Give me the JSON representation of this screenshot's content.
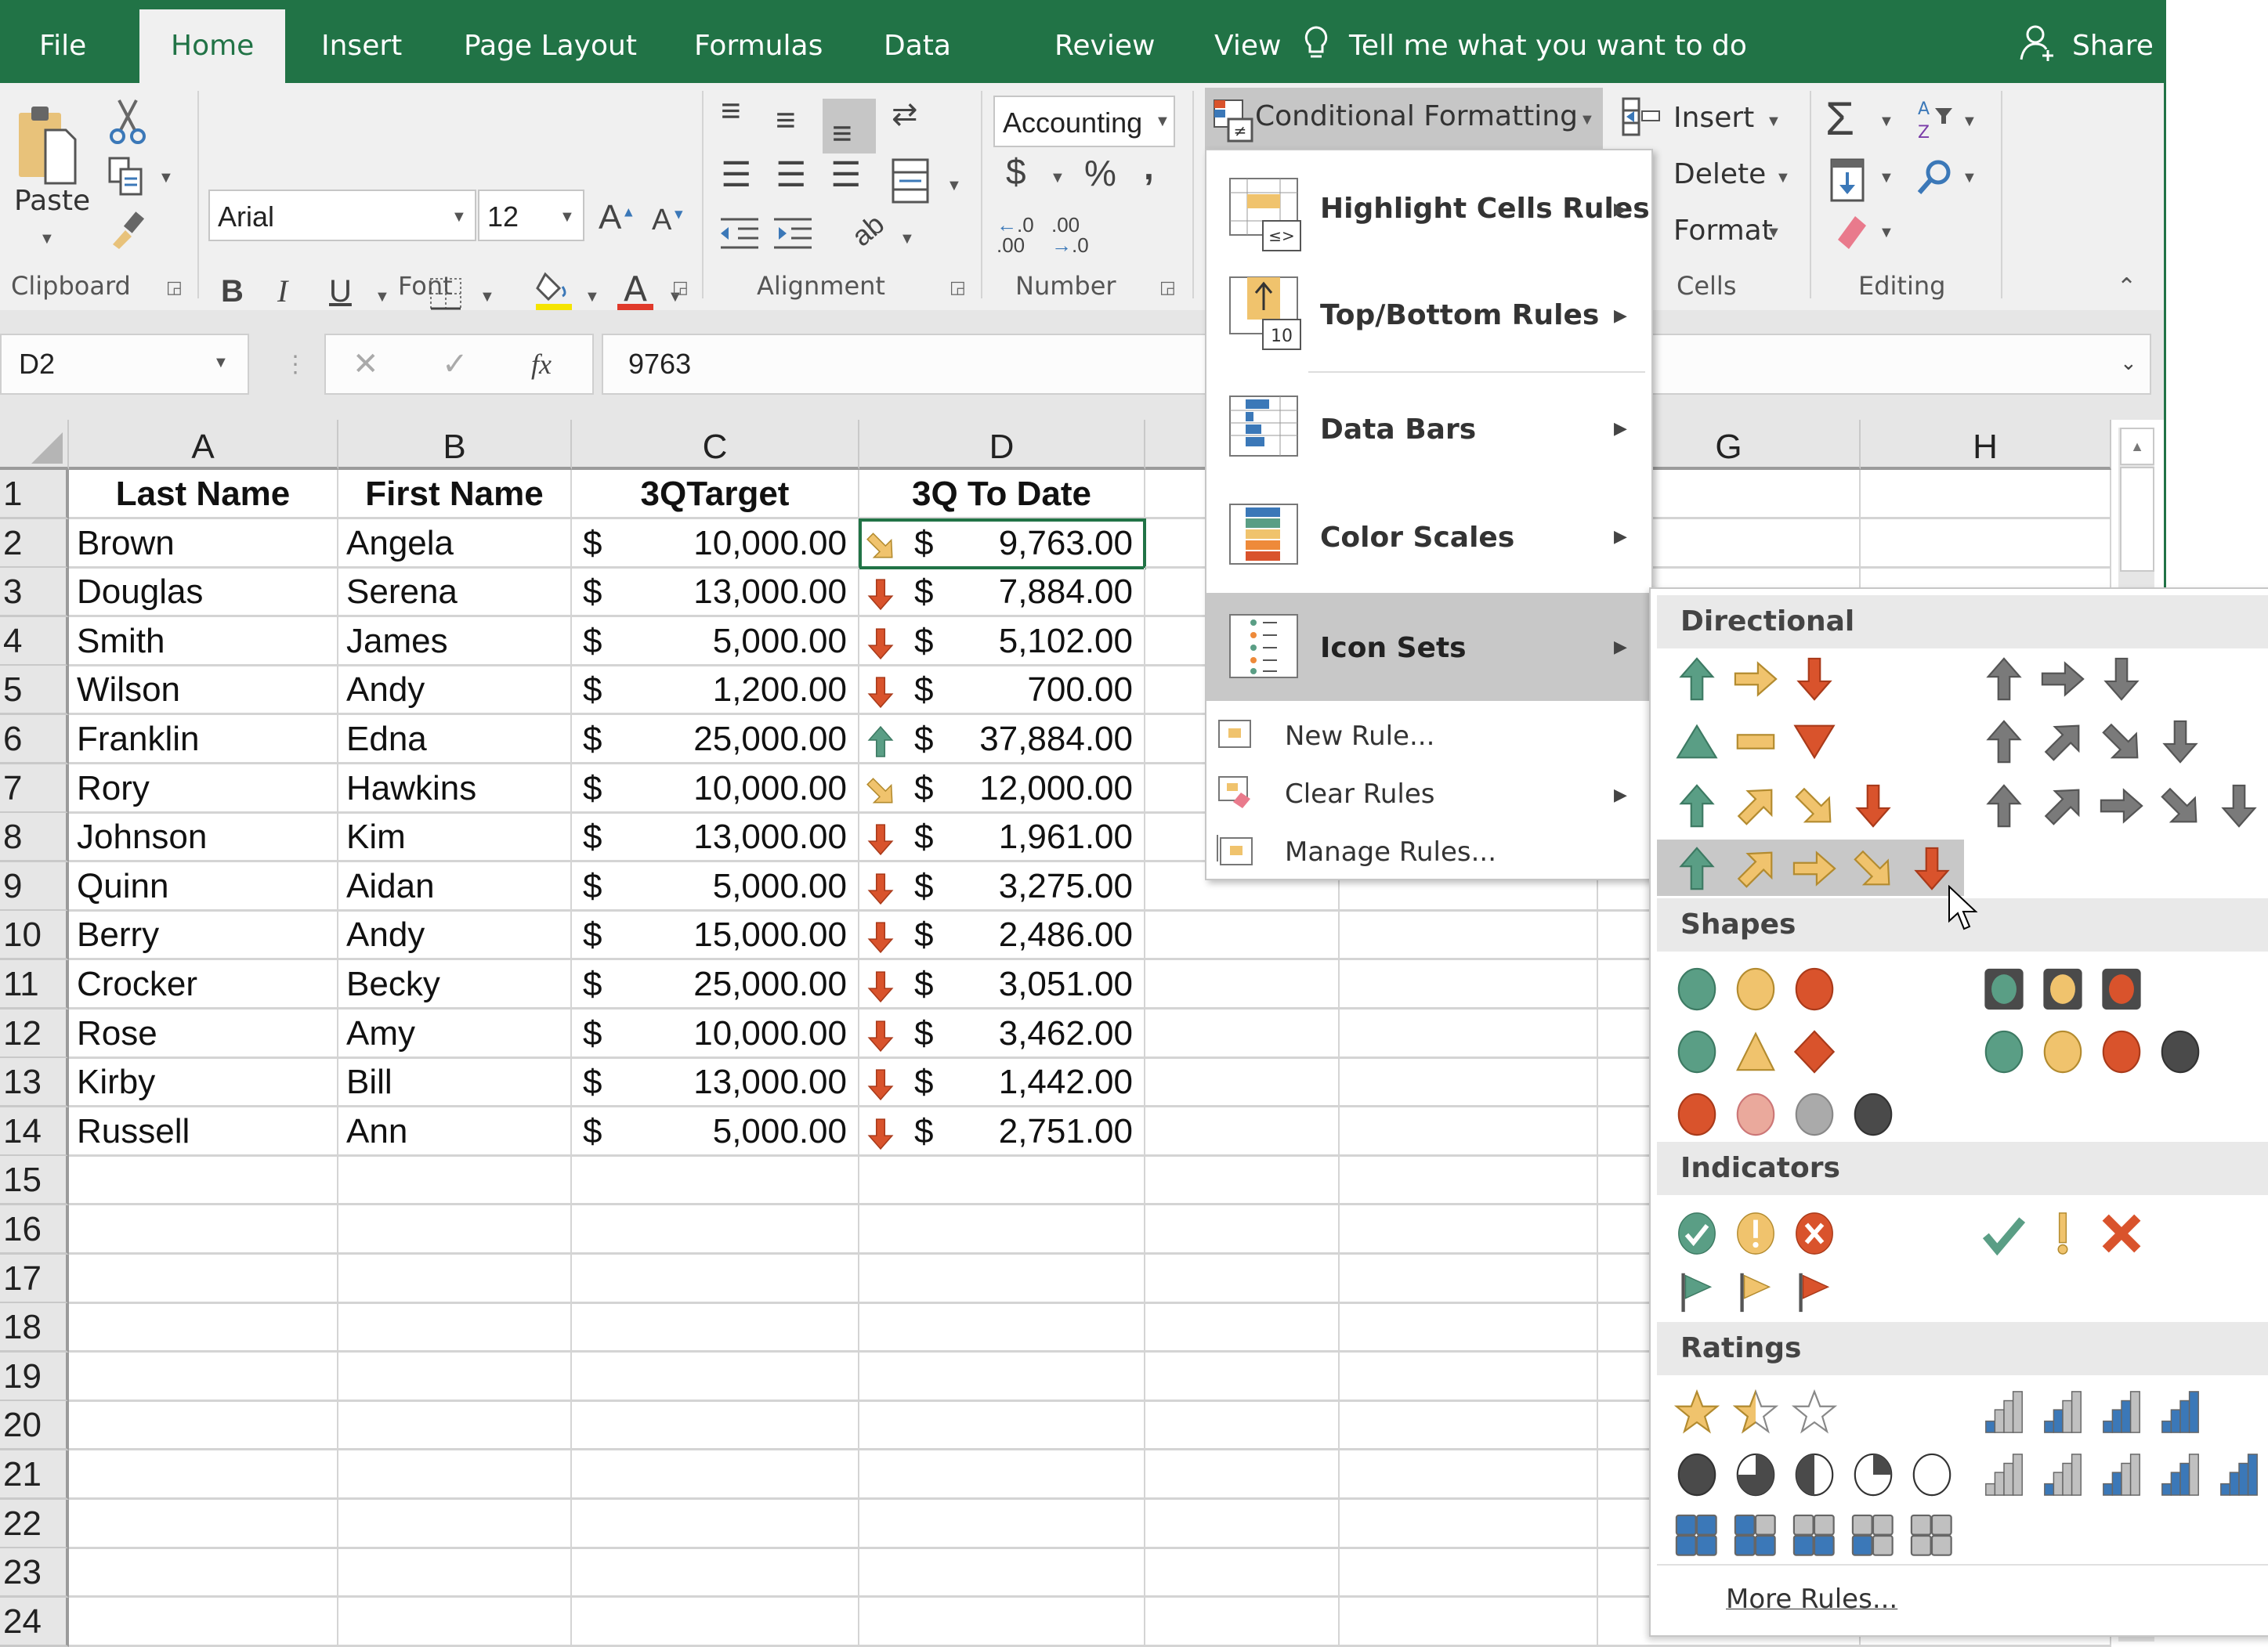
{
  "tabs": [
    "File",
    "Home",
    "Insert",
    "Page Layout",
    "Formulas",
    "Data",
    "Review",
    "View"
  ],
  "active_tab": "Home",
  "tell_me": "Tell me what you want to do",
  "share": "Share",
  "ribbon": {
    "clipboard": {
      "label": "Clipboard",
      "paste": "Paste"
    },
    "font": {
      "label": "Font",
      "font_name": "Arial",
      "font_size": "12",
      "bold": "B",
      "italic": "I",
      "underline": "U"
    },
    "alignment": {
      "label": "Alignment"
    },
    "number": {
      "label": "Number",
      "format": "Accounting",
      "currency": "$",
      "percent": "%",
      "comma": ","
    },
    "styles": {
      "conditional_formatting": "Conditional Formatting"
    },
    "cells": {
      "label": "Cells",
      "insert": "Insert",
      "delete": "Delete",
      "format": "Format"
    },
    "editing": {
      "label": "Editing"
    }
  },
  "formula_bar": {
    "name_box": "D2",
    "value": "9763",
    "fx": "fx"
  },
  "columns": [
    "A",
    "B",
    "C",
    "D",
    "G",
    "H"
  ],
  "rows": [
    "1",
    "2",
    "3",
    "4",
    "5",
    "6",
    "7",
    "8",
    "9",
    "10",
    "11",
    "12",
    "13",
    "14",
    "15",
    "16",
    "17",
    "18",
    "19",
    "20",
    "21",
    "22",
    "23",
    "24"
  ],
  "table": {
    "headers": [
      "Last Name",
      "First Name",
      "3QTarget",
      "3Q To Date"
    ],
    "currency_symbol": "$",
    "records": [
      {
        "last": "Brown",
        "first": "Angela",
        "target": "10,000.00",
        "to_date": "9,763.00",
        "icon": "arrow-down-right-yellow"
      },
      {
        "last": "Douglas",
        "first": "Serena",
        "target": "13,000.00",
        "to_date": "7,884.00",
        "icon": "arrow-down-red"
      },
      {
        "last": "Smith",
        "first": "James",
        "target": "5,000.00",
        "to_date": "5,102.00",
        "icon": "arrow-down-red"
      },
      {
        "last": "Wilson",
        "first": "Andy",
        "target": "1,200.00",
        "to_date": "700.00",
        "icon": "arrow-down-red"
      },
      {
        "last": "Franklin",
        "first": "Edna",
        "target": "25,000.00",
        "to_date": "37,884.00",
        "icon": "arrow-up-green"
      },
      {
        "last": "Rory",
        "first": "Hawkins",
        "target": "10,000.00",
        "to_date": "12,000.00",
        "icon": "arrow-down-right-yellow"
      },
      {
        "last": "Johnson",
        "first": "Kim",
        "target": "13,000.00",
        "to_date": "1,961.00",
        "icon": "arrow-down-red"
      },
      {
        "last": "Quinn",
        "first": "Aidan",
        "target": "5,000.00",
        "to_date": "3,275.00",
        "icon": "arrow-down-red"
      },
      {
        "last": "Berry",
        "first": "Andy",
        "target": "15,000.00",
        "to_date": "2,486.00",
        "icon": "arrow-down-red"
      },
      {
        "last": "Crocker",
        "first": "Becky",
        "target": "25,000.00",
        "to_date": "3,051.00",
        "icon": "arrow-down-red"
      },
      {
        "last": "Rose",
        "first": "Amy",
        "target": "10,000.00",
        "to_date": "3,462.00",
        "icon": "arrow-down-red"
      },
      {
        "last": "Kirby",
        "first": "Bill",
        "target": "13,000.00",
        "to_date": "1,442.00",
        "icon": "arrow-down-red"
      },
      {
        "last": "Russell",
        "first": "Ann",
        "target": "5,000.00",
        "to_date": "2,751.00",
        "icon": "arrow-down-red"
      }
    ]
  },
  "cf_menu": {
    "items": [
      {
        "label": "Highlight Cells Rules",
        "submenu": true
      },
      {
        "label": "Top/Bottom Rules",
        "submenu": true
      },
      {
        "label": "Data Bars",
        "submenu": true
      },
      {
        "label": "Color Scales",
        "submenu": true
      },
      {
        "label": "Icon Sets",
        "submenu": true,
        "highlighted": true
      },
      {
        "label": "New Rule...",
        "submenu": false
      },
      {
        "label": "Clear Rules",
        "submenu": true
      },
      {
        "label": "Manage Rules...",
        "submenu": false
      }
    ]
  },
  "icon_sets": {
    "sections": [
      "Directional",
      "Shapes",
      "Indicators",
      "Ratings"
    ],
    "more_rules": "More Rules...",
    "hovered_set": "5 Arrows (Colored)"
  },
  "colors": {
    "excel_green": "#217346",
    "green": "#5a9e85",
    "yellow": "#f0c36d",
    "red": "#d9532c",
    "gray": "#7a7a7a",
    "dark": "#4a4a4a",
    "blue": "#3b78b8"
  }
}
